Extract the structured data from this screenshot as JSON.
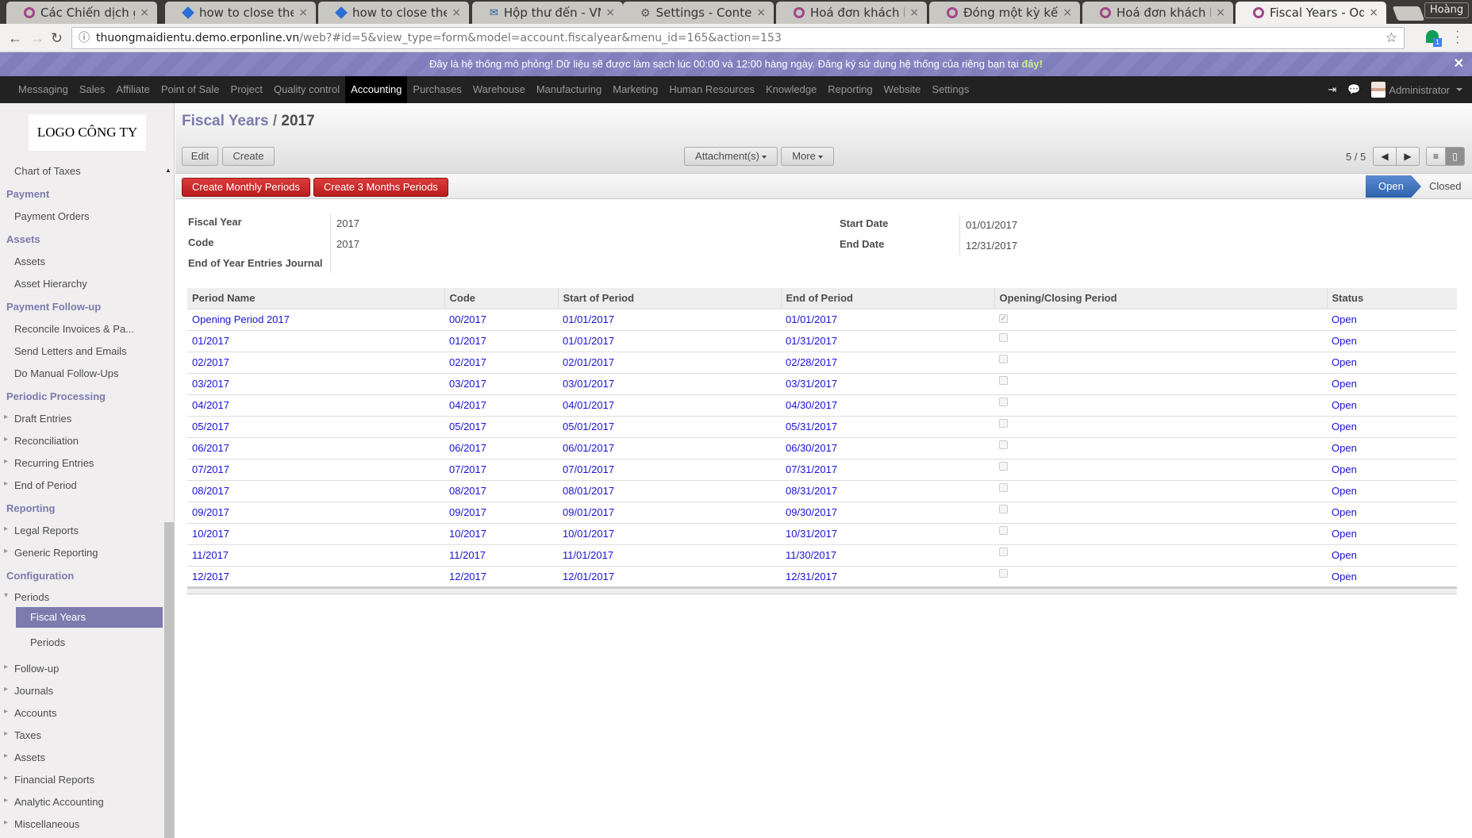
{
  "browser": {
    "tabs": [
      {
        "label": "Các Chiến dịch gửi",
        "icon": "odoo"
      },
      {
        "label": "how to close the pe",
        "icon": "so"
      },
      {
        "label": "how to close the pe",
        "icon": "so"
      },
      {
        "label": "Hộp thư đến - VNI",
        "icon": "mail"
      },
      {
        "label": "Settings - Content s",
        "icon": "gear"
      },
      {
        "label": "Hoá đơn khách hàn",
        "icon": "odoo"
      },
      {
        "label": "Đóng một kỳ kế t",
        "icon": "odoo"
      },
      {
        "label": "Hoá đơn khách hàn",
        "icon": "odoo"
      },
      {
        "label": "Fiscal Years - Odoo",
        "icon": "odoo"
      }
    ],
    "profile": "Hoàng",
    "url_host": "thuongmaidientu.demo.erponline.vn",
    "url_path": "/web?#id=5&view_type=form&model=account.fiscalyear&menu_id=165&action=153",
    "ext_badge": "1"
  },
  "banner": {
    "text": "Đây là hệ thống mô phỏng! Dữ liệu sẽ được làm sạch lúc 00:00 và 12:00 hàng ngày. Đăng ký sử dụng hệ thống của riêng bạn tại ",
    "link": "đây!",
    "close": "✕"
  },
  "topmenu": {
    "items": [
      "Messaging",
      "Sales",
      "Affiliate",
      "Point of Sale",
      "Project",
      "Quality control",
      "Accounting",
      "Purchases",
      "Warehouse",
      "Manufacturing",
      "Marketing",
      "Human Resources",
      "Knowledge",
      "Reporting",
      "Website",
      "Settings"
    ],
    "active": "Accounting",
    "user": "Administrator"
  },
  "sidebar": {
    "logo": "LOGO CÔNG TY",
    "items": [
      {
        "type": "item",
        "label": "Chart of Taxes"
      },
      {
        "type": "head",
        "label": "Payment"
      },
      {
        "type": "item",
        "label": "Payment Orders"
      },
      {
        "type": "head",
        "label": "Assets"
      },
      {
        "type": "item",
        "label": "Assets"
      },
      {
        "type": "item",
        "label": "Asset Hierarchy"
      },
      {
        "type": "head",
        "label": "Payment Follow-up"
      },
      {
        "type": "item",
        "label": "Reconcile Invoices & Pa..."
      },
      {
        "type": "item",
        "label": "Send Letters and Emails"
      },
      {
        "type": "item",
        "label": "Do Manual Follow-Ups"
      },
      {
        "type": "head",
        "label": "Periodic Processing"
      },
      {
        "type": "tri",
        "label": "Draft Entries"
      },
      {
        "type": "tri",
        "label": "Reconciliation"
      },
      {
        "type": "tri",
        "label": "Recurring Entries"
      },
      {
        "type": "tri",
        "label": "End of Period"
      },
      {
        "type": "head",
        "label": "Reporting"
      },
      {
        "type": "tri",
        "label": "Legal Reports"
      },
      {
        "type": "tri",
        "label": "Generic Reporting"
      },
      {
        "type": "head",
        "label": "Configuration"
      },
      {
        "type": "tri-open",
        "label": "Periods"
      },
      {
        "type": "selected",
        "label": "Fiscal Years"
      },
      {
        "type": "sub",
        "label": "Periods"
      },
      {
        "type": "tri",
        "label": "Follow-up"
      },
      {
        "type": "tri",
        "label": "Journals"
      },
      {
        "type": "tri",
        "label": "Accounts"
      },
      {
        "type": "tri",
        "label": "Taxes"
      },
      {
        "type": "tri",
        "label": "Assets"
      },
      {
        "type": "tri",
        "label": "Financial Reports"
      },
      {
        "type": "tri",
        "label": "Analytic Accounting"
      },
      {
        "type": "tri",
        "label": "Miscellaneous"
      }
    ]
  },
  "control_panel": {
    "breadcrumb_parent": "Fiscal Years",
    "breadcrumb_sep": " / ",
    "breadcrumb_current": "2017",
    "edit": "Edit",
    "create": "Create",
    "attachments": "Attachment(s)",
    "more": "More",
    "pager": "5 / 5"
  },
  "statusbar": {
    "create_monthly": "Create Monthly Periods",
    "create_3months": "Create 3 Months Periods",
    "states": [
      "Open",
      "Closed"
    ],
    "current": "Open"
  },
  "form": {
    "fiscal_year_label": "Fiscal Year",
    "fiscal_year": "2017",
    "code_label": "Code",
    "code": "2017",
    "journal_label": "End of Year Entries Journal",
    "journal": "",
    "start_label": "Start Date",
    "start": "01/01/2017",
    "end_label": "End Date",
    "end": "12/31/2017"
  },
  "periods": {
    "headers": [
      "Period Name",
      "Code",
      "Start of Period",
      "End of Period",
      "Opening/Closing Period",
      "Status"
    ],
    "rows": [
      {
        "name": "Opening Period 2017",
        "code": "00/2017",
        "start": "01/01/2017",
        "end": "01/01/2017",
        "opening": true,
        "status": "Open"
      },
      {
        "name": "01/2017",
        "code": "01/2017",
        "start": "01/01/2017",
        "end": "01/31/2017",
        "opening": false,
        "status": "Open"
      },
      {
        "name": "02/2017",
        "code": "02/2017",
        "start": "02/01/2017",
        "end": "02/28/2017",
        "opening": false,
        "status": "Open"
      },
      {
        "name": "03/2017",
        "code": "03/2017",
        "start": "03/01/2017",
        "end": "03/31/2017",
        "opening": false,
        "status": "Open"
      },
      {
        "name": "04/2017",
        "code": "04/2017",
        "start": "04/01/2017",
        "end": "04/30/2017",
        "opening": false,
        "status": "Open"
      },
      {
        "name": "05/2017",
        "code": "05/2017",
        "start": "05/01/2017",
        "end": "05/31/2017",
        "opening": false,
        "status": "Open"
      },
      {
        "name": "06/2017",
        "code": "06/2017",
        "start": "06/01/2017",
        "end": "06/30/2017",
        "opening": false,
        "status": "Open"
      },
      {
        "name": "07/2017",
        "code": "07/2017",
        "start": "07/01/2017",
        "end": "07/31/2017",
        "opening": false,
        "status": "Open"
      },
      {
        "name": "08/2017",
        "code": "08/2017",
        "start": "08/01/2017",
        "end": "08/31/2017",
        "opening": false,
        "status": "Open"
      },
      {
        "name": "09/2017",
        "code": "09/2017",
        "start": "09/01/2017",
        "end": "09/30/2017",
        "opening": false,
        "status": "Open"
      },
      {
        "name": "10/2017",
        "code": "10/2017",
        "start": "10/01/2017",
        "end": "10/31/2017",
        "opening": false,
        "status": "Open"
      },
      {
        "name": "11/2017",
        "code": "11/2017",
        "start": "11/01/2017",
        "end": "11/30/2017",
        "opening": false,
        "status": "Open"
      },
      {
        "name": "12/2017",
        "code": "12/2017",
        "start": "12/01/2017",
        "end": "12/31/2017",
        "opening": false,
        "status": "Open"
      }
    ]
  }
}
